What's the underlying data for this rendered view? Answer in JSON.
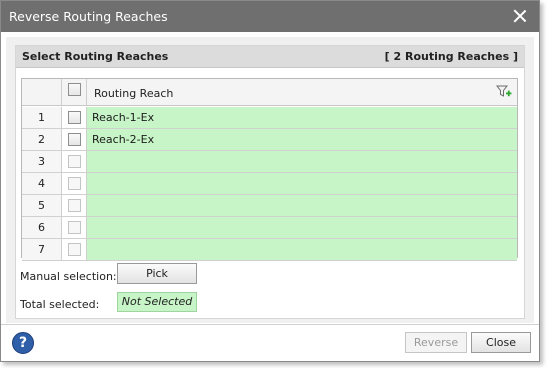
{
  "window": {
    "title": "Reverse Routing Reaches"
  },
  "section": {
    "title": "Select Routing Reaches",
    "count": "[ 2 Routing Reaches ]"
  },
  "grid": {
    "column_header": "Routing Reach",
    "rows": [
      {
        "num": "1",
        "value": "Reach-1-Ex",
        "checked": false,
        "enabled": true
      },
      {
        "num": "2",
        "value": "Reach-2-Ex",
        "checked": false,
        "enabled": true
      },
      {
        "num": "3",
        "value": "",
        "checked": false,
        "enabled": false
      },
      {
        "num": "4",
        "value": "",
        "checked": false,
        "enabled": false
      },
      {
        "num": "5",
        "value": "",
        "checked": false,
        "enabled": false
      },
      {
        "num": "6",
        "value": "",
        "checked": false,
        "enabled": false
      },
      {
        "num": "7",
        "value": "",
        "checked": false,
        "enabled": false
      }
    ]
  },
  "manual_selection": {
    "label": "Manual selection:",
    "button": "Pick"
  },
  "total_selected": {
    "label": "Total selected:",
    "value": "Not Selected"
  },
  "footer": {
    "reverse_label": "Reverse",
    "close_label": "Close",
    "help_symbol": "?"
  },
  "colors": {
    "titlebar": "#6f6f6f",
    "row_fill": "#c8f5c8",
    "help": "#2e5fa8"
  },
  "icons": {
    "close": "close-icon",
    "filter": "filter-add-icon",
    "help": "help-icon"
  }
}
